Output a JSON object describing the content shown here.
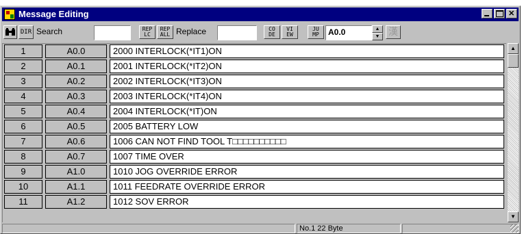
{
  "window": {
    "title": "Message Editing"
  },
  "toolbar": {
    "search_label": "Search",
    "search_value": "",
    "replace_label": "Replace",
    "replace_value": "",
    "address_value": "A0.0",
    "dir_btn": "DIR",
    "rep_lc": [
      "REP",
      "LC"
    ],
    "rep_all": [
      "REP",
      "ALL"
    ],
    "code_btn": [
      "CO",
      "DE"
    ],
    "view_btn": [
      "VI",
      "EW"
    ],
    "jump_btn": [
      "JU",
      "MP"
    ],
    "kanji_label": "漢"
  },
  "rows": [
    {
      "num": "1",
      "addr": "A0.0",
      "msg": "2000 INTERLOCK(*IT1)ON"
    },
    {
      "num": "2",
      "addr": "A0.1",
      "msg": "2001 INTERLOCK(*IT2)ON"
    },
    {
      "num": "3",
      "addr": "A0.2",
      "msg": "2002 INTERLOCK(*IT3)ON"
    },
    {
      "num": "4",
      "addr": "A0.3",
      "msg": "2003 INTERLOCK(*IT4)ON"
    },
    {
      "num": "5",
      "addr": "A0.4",
      "msg": "2004 INTERLOCK(*IT)ON"
    },
    {
      "num": "6",
      "addr": "A0.5",
      "msg": "2005 BATTERY LOW"
    },
    {
      "num": "7",
      "addr": "A0.6",
      "msg": "1006 CAN NOT FIND TOOL T□□□□□□□□□□"
    },
    {
      "num": "8",
      "addr": "A0.7",
      "msg": "1007 TIME OVER"
    },
    {
      "num": "9",
      "addr": "A1.0",
      "msg": "1010 JOG OVERRIDE ERROR"
    },
    {
      "num": "10",
      "addr": "A1.1",
      "msg": "1011 FEEDRATE OVERRIDE ERROR"
    },
    {
      "num": "11",
      "addr": "A1.2",
      "msg": "1012 SOV ERROR"
    }
  ],
  "status": {
    "position": "No.1  22 Byte"
  },
  "colors": {
    "title_bar": "#000080",
    "window_face": "#c0c0c0"
  }
}
